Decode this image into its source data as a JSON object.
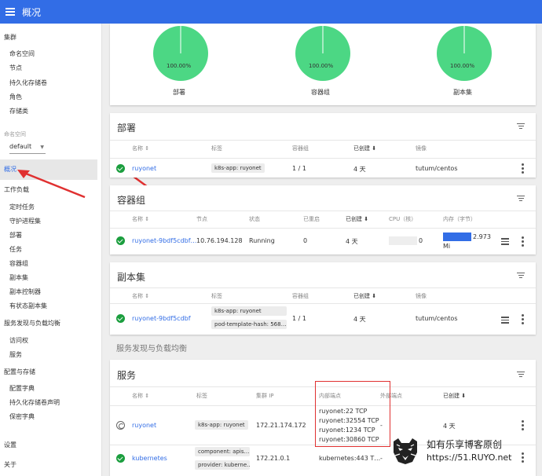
{
  "topbar": {
    "title": "概况"
  },
  "sidebar": {
    "cluster": "集群",
    "cluster_items": [
      "命名空间",
      "节点",
      "持久化存储卷",
      "角色",
      "存储类"
    ],
    "namespace_label": "命名空间",
    "namespace_value": "default",
    "overview": "概况",
    "workloads": "工作负载",
    "workload_items": [
      "定时任务",
      "守护进程集",
      "部署",
      "任务",
      "容器组",
      "副本集",
      "副本控制器",
      "有状态副本集"
    ],
    "discovery": "服务发现与负载均衡",
    "discovery_items": [
      "访问权",
      "服务"
    ],
    "config": "配置与存储",
    "config_items": [
      "配置字典",
      "持久化存储卷声明",
      "保密字典"
    ],
    "settings": "设置",
    "about": "关于"
  },
  "status_card": {
    "charts": [
      {
        "label": "部署",
        "percent": "100.00%"
      },
      {
        "label": "容器组",
        "percent": "100.00%"
      },
      {
        "label": "副本集",
        "percent": "100.00%"
      }
    ]
  },
  "deployments": {
    "title": "部署",
    "headers": [
      "名称",
      "标签",
      "容器组",
      "已创建",
      "镜像"
    ],
    "rows": [
      {
        "name": "ruyonet",
        "label": "k8s-app: ruyonet",
        "pods": "1 / 1",
        "created": "4 天",
        "image": "tutum/centos"
      }
    ]
  },
  "pods": {
    "title": "容器组",
    "headers": [
      "名称",
      "节点",
      "状态",
      "已重启",
      "已创建",
      "CPU（核）",
      "内存（字节）"
    ],
    "rows": [
      {
        "name": "ruyonet-9bdf5cdbf…",
        "node": "10.76.194.128",
        "status": "Running",
        "restarts": "0",
        "created": "4 天",
        "cpu": "0",
        "memory": "2.973 Mi"
      }
    ]
  },
  "replicasets": {
    "title": "副本集",
    "headers": [
      "名称",
      "标签",
      "容器组",
      "已创建",
      "镜像"
    ],
    "rows": [
      {
        "name": "ruyonet-9bdf5cdbf",
        "labels": [
          "k8s-app: ruyonet",
          "pod-template-hash: 568…"
        ],
        "pods": "1 / 1",
        "created": "4 天",
        "image": "tutum/centos"
      }
    ]
  },
  "discovery_header": "服务发现与负载均衡",
  "services": {
    "title": "服务",
    "headers": [
      "名称",
      "标签",
      "集群 IP",
      "内部端点",
      "外部端点",
      "已创建"
    ],
    "rows": [
      {
        "name": "ruyonet",
        "labels": [
          "k8s-app: ruyonet"
        ],
        "cluster_ip": "172.21.174.172",
        "internal": [
          "ruyonet:22 TCP",
          "ruyonet:32554 TCP",
          "ruyonet:1234 TCP",
          "ruyonet:30860 TCP"
        ],
        "external": "-",
        "created": "4 天"
      },
      {
        "name": "kubernetes",
        "labels": [
          "component: apis…",
          "provider: kuberne…"
        ],
        "cluster_ip": "172.21.0.1",
        "internal": [
          "kubernetes:443 T…"
        ],
        "external": "-",
        "created": ""
      }
    ]
  },
  "watermark": {
    "line1": "如有乐享博客原创",
    "line2": "https://51.RUYO.net"
  },
  "colors": {
    "primary": "#326de6",
    "success": "#1b9e3e",
    "donut": "#4cd784",
    "annotation": "#e03030"
  }
}
